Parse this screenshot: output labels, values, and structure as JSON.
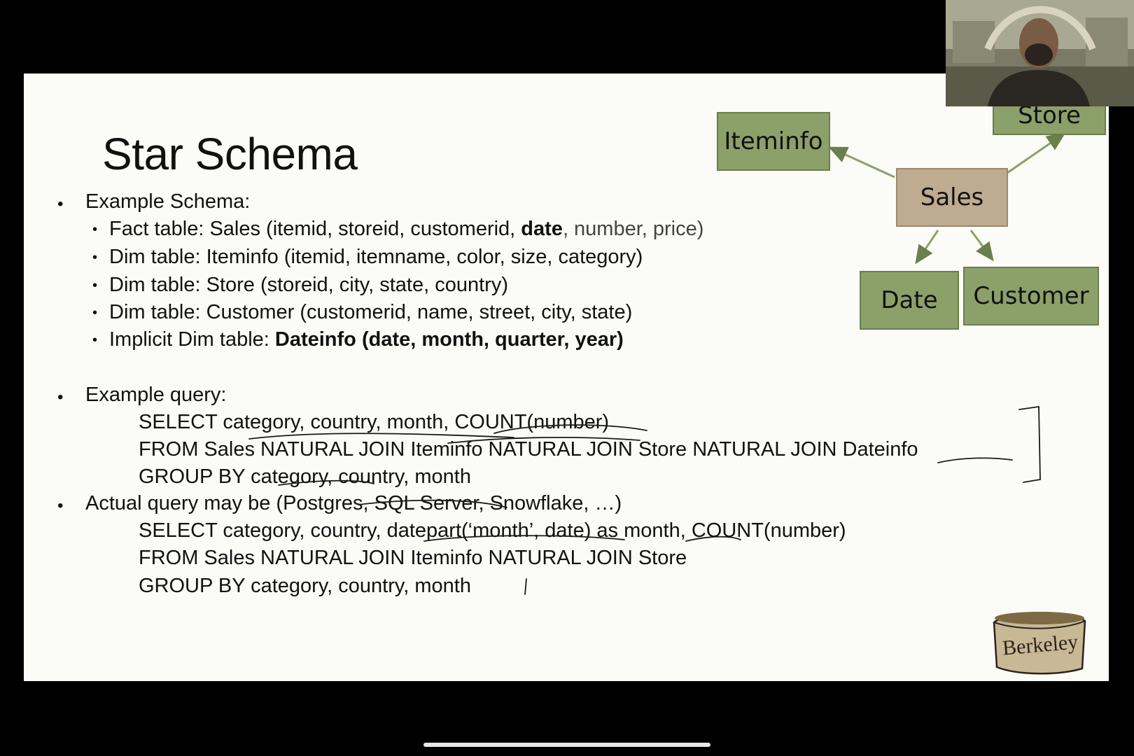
{
  "slide": {
    "title": "Star Schema",
    "schema_heading": "Example Schema:",
    "fact_prefix": "Fact table: Sales (itemid, storeid, customerid, ",
    "fact_bold": "date",
    "fact_grey": ", number, price)",
    "dim1": "Dim table: Iteminfo (itemid, itemname, color, size, category)",
    "dim2": "Dim table: Store (storeid, city, state, country)",
    "dim3": "Dim table: Customer (customerid, name, street, city, state)",
    "implicit_prefix": "Implicit Dim table: ",
    "implicit_bold": "Dateinfo (date, month, quarter, year)",
    "query_heading": "Example query:",
    "q1": "SELECT category, country, month, COUNT(number)",
    "q2": "FROM Sales NATURAL JOIN Iteminfo NATURAL JOIN Store NATURAL JOIN Dateinfo",
    "q3": "GROUP BY category, country, month",
    "actual_heading": "Actual query may be (Postgres, SQL Server, Snowflake, …)",
    "a1": "SELECT category, country, datepart(‘month’, date) as month, COUNT(number)",
    "a2": "FROM Sales NATURAL JOIN Iteminfo NATURAL JOIN Store",
    "a3": "GROUP BY category, country, month"
  },
  "diagram": {
    "iteminfo": "Iteminfo",
    "store": "Store",
    "sales": "Sales",
    "date": "Date",
    "customer": "Customer"
  },
  "logo": {
    "text": "Berkeley"
  },
  "colors": {
    "dim_fill": "#8ca06a",
    "fact_fill": "#bfab8f",
    "ink": "#1a1a1a"
  }
}
